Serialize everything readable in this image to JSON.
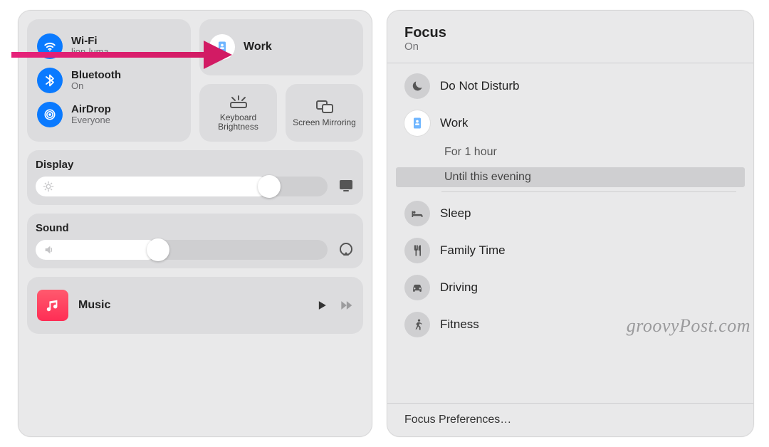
{
  "control_center": {
    "wifi": {
      "title": "Wi-Fi",
      "subtitle": "lion-luma"
    },
    "bluetooth": {
      "title": "Bluetooth",
      "subtitle": "On"
    },
    "airdrop": {
      "title": "AirDrop",
      "subtitle": "Everyone"
    },
    "focus_tile": {
      "label": "Work"
    },
    "keyboard_brightness": {
      "label": "Keyboard Brightness"
    },
    "screen_mirroring": {
      "label": "Screen Mirroring"
    },
    "display": {
      "label": "Display",
      "value_pct": 80
    },
    "sound": {
      "label": "Sound",
      "value_pct": 42
    },
    "music": {
      "label": "Music"
    }
  },
  "focus_panel": {
    "title": "Focus",
    "status": "On",
    "modes": {
      "dnd": "Do Not Disturb",
      "work": "Work",
      "sleep": "Sleep",
      "family": "Family Time",
      "driving": "Driving",
      "fitness": "Fitness"
    },
    "work_options": {
      "one_hour": "For 1 hour",
      "until_evening": "Until this evening"
    },
    "preferences": "Focus Preferences…"
  },
  "watermark": "groovyPost.com"
}
